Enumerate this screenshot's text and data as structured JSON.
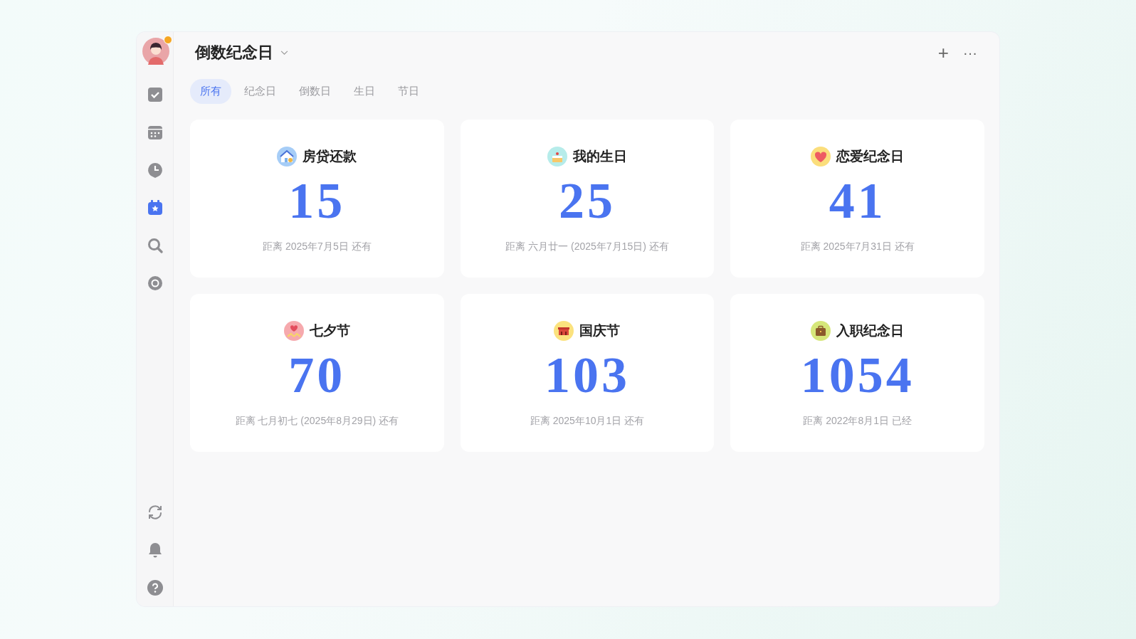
{
  "sidebar": {
    "nav": [
      {
        "kind": "tasks",
        "selected": false
      },
      {
        "kind": "calendar",
        "selected": false
      },
      {
        "kind": "clock",
        "selected": false
      },
      {
        "kind": "star-calendar",
        "selected": true
      },
      {
        "kind": "search",
        "selected": false
      },
      {
        "kind": "target",
        "selected": false
      }
    ],
    "bottom": [
      {
        "kind": "sync"
      },
      {
        "kind": "bell"
      },
      {
        "kind": "help"
      }
    ]
  },
  "header": {
    "title": "倒数纪念日",
    "add_label": "+",
    "more_label": "···"
  },
  "tabs": [
    {
      "label": "所有",
      "selected": true
    },
    {
      "label": "纪念日",
      "selected": false
    },
    {
      "label": "倒数日",
      "selected": false
    },
    {
      "label": "生日",
      "selected": false
    },
    {
      "label": "节日",
      "selected": false
    }
  ],
  "cards": [
    {
      "title": "房贷还款",
      "kind": "house",
      "color": "#a6cdf7",
      "days": "15",
      "caption": "距离 2025年7月5日 还有"
    },
    {
      "title": "我的生日",
      "kind": "cake",
      "color": "#b6ecea",
      "days": "25",
      "caption": "距离 六月廿一 (2025年7月15日) 还有"
    },
    {
      "title": "恋爱纪念日",
      "kind": "heart",
      "color": "#fbde7c",
      "days": "41",
      "caption": "距离 2025年7月31日 还有"
    },
    {
      "title": "七夕节",
      "kind": "couple",
      "color": "#f6a9ad",
      "days": "70",
      "caption": "距离 七月初七 (2025年8月29日) 还有"
    },
    {
      "title": "国庆节",
      "kind": "gate",
      "color": "#fbe27e",
      "days": "103",
      "caption": "距离 2025年10月1日 还有"
    },
    {
      "title": "入职纪念日",
      "kind": "briefcase",
      "color": "#d6e77a",
      "days": "1054",
      "caption": "距离 2022年8月1日 已经"
    }
  ]
}
